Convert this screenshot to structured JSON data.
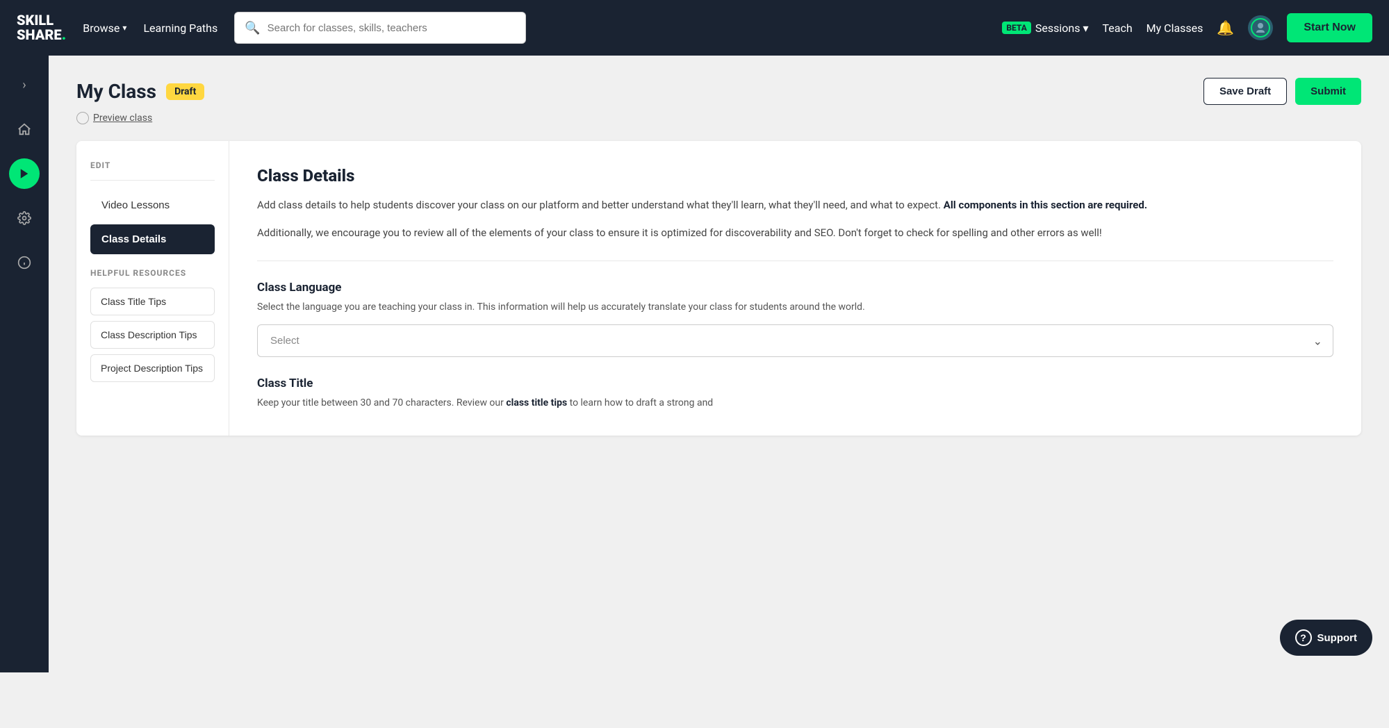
{
  "navbar": {
    "logo_line1": "SKILL",
    "logo_line2": "SHARE",
    "browse_label": "Browse",
    "learning_paths_label": "Learning Paths",
    "search_placeholder": "Search for classes, skills, teachers",
    "beta_label": "BETA",
    "sessions_label": "Sessions",
    "teach_label": "Teach",
    "my_classes_label": "My Classes",
    "start_now_label": "Start Now"
  },
  "sidebar": {
    "items": [
      {
        "name": "expand-icon",
        "symbol": "›",
        "active": false
      },
      {
        "name": "home-icon",
        "symbol": "⌂",
        "active": false
      },
      {
        "name": "play-icon",
        "symbol": "▶",
        "active": true
      },
      {
        "name": "gear-icon",
        "symbol": "⚙",
        "active": false
      },
      {
        "name": "info-icon",
        "symbol": "ℹ",
        "active": false
      }
    ]
  },
  "page": {
    "title": "My Class",
    "draft_badge": "Draft",
    "preview_link": "Preview class",
    "save_draft_label": "Save Draft",
    "submit_label": "Submit"
  },
  "left_panel": {
    "edit_label": "EDIT",
    "menu_items": [
      {
        "label": "Video Lessons",
        "active": false
      },
      {
        "label": "Class Details",
        "active": true
      }
    ],
    "helpful_label": "HELPFUL RESOURCES",
    "resources": [
      {
        "label": "Class Title Tips"
      },
      {
        "label": "Class Description Tips"
      },
      {
        "label": "Project Description Tips"
      }
    ]
  },
  "right_panel": {
    "section_title": "Class Details",
    "desc1": "Add class details to help students discover your class on our platform and better understand what they'll learn, what they'll need, and what to expect.",
    "desc1_bold": " All components in this section are required.",
    "desc2": "Additionally, we encourage you to review all of the elements of your class to ensure it is optimized for discoverability and SEO. Don't forget to check for spelling and other errors as well!",
    "language_label": "Class Language",
    "language_desc": "Select the language you are teaching your class in. This information will help us accurately translate your class for students around the world.",
    "language_select_placeholder": "Select",
    "title_label": "Class Title",
    "title_desc_prefix": "Keep your title between 30 and 70 characters. Review our ",
    "title_desc_link": "class title tips",
    "title_desc_suffix": " to learn how to draft a strong and"
  },
  "support": {
    "label": "Support"
  }
}
